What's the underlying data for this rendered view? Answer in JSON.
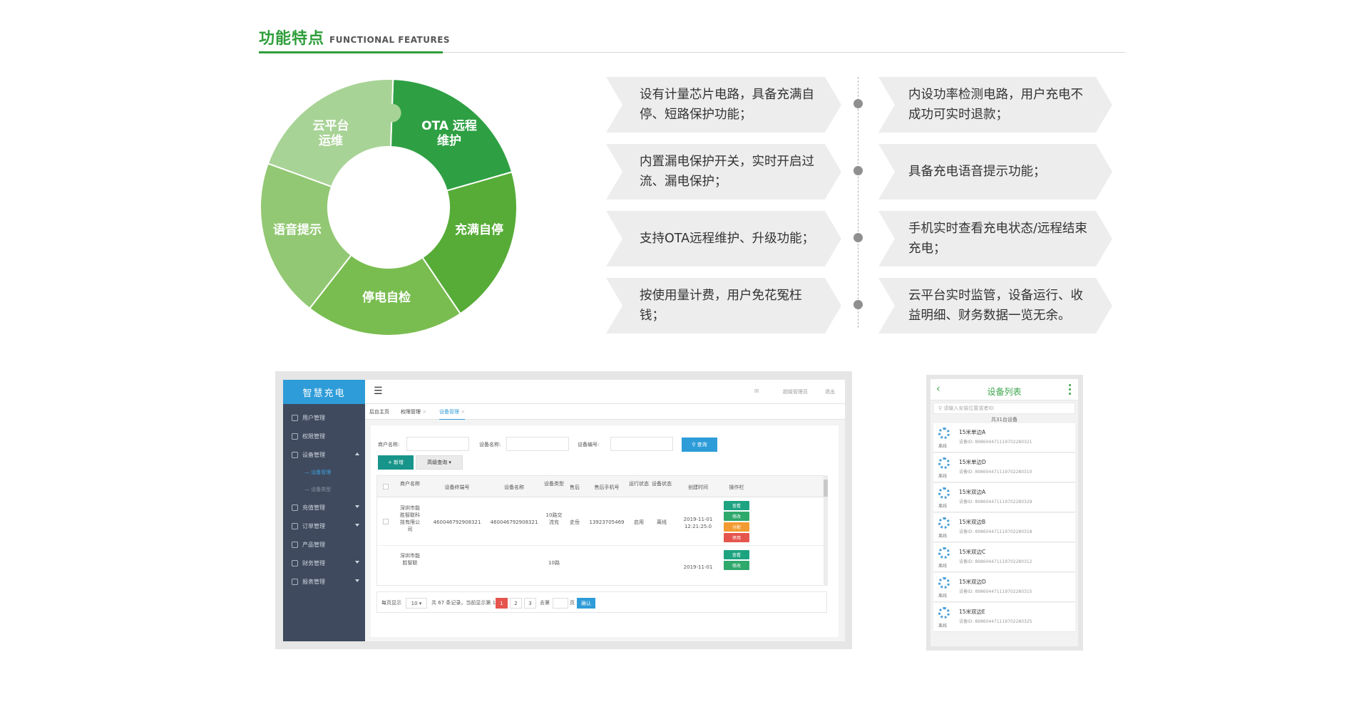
{
  "header": {
    "title_cn": "功能特点",
    "title_en": "FUNCTIONAL FEATURES"
  },
  "wheel": {
    "segments": [
      "OTA 远程维护",
      "充满自停",
      "停电自检",
      "语音提示",
      "云平台运维"
    ],
    "colors": [
      "#2ea043",
      "#57ac38",
      "#79bd50",
      "#92c873",
      "#a8d396"
    ]
  },
  "features": {
    "left": [
      "设有计量芯片电路，具备充满自停、短路保护功能；",
      "内置漏电保护开关，实时开启过流、漏电保护；",
      "支持OTA远程维护、升级功能；",
      "按使用量计费，用户免花冤枉钱；"
    ],
    "right": [
      "内设功率检测电路，用户充电不成功可实时退款；",
      "具备充电语音提示功能；",
      "手机实时查看充电状态/远程结束充电；",
      "云平台实时监管，设备运行、收益明细、财务数据一览无余。"
    ]
  },
  "admin": {
    "logo": "智慧充电",
    "menu_icon": "hamburger-icon",
    "top_right": [
      "☒",
      "超级管理员",
      "退出"
    ],
    "sidebar": [
      {
        "label": "用户管理",
        "icon": "user-icon"
      },
      {
        "label": "权限管理",
        "icon": "key-icon"
      },
      {
        "label": "设备管理",
        "icon": "device-icon"
      },
      {
        "label": "设备管理",
        "icon": "sub-item"
      },
      {
        "label": "设备类型",
        "icon": "sub-item"
      },
      {
        "label": "充值管理",
        "icon": "recharge-icon"
      },
      {
        "label": "订单管理",
        "icon": "order-icon"
      },
      {
        "label": "产品管理",
        "icon": "product-icon"
      },
      {
        "label": "财务管理",
        "icon": "finance-icon"
      },
      {
        "label": "报表管理",
        "icon": "report-icon"
      }
    ],
    "tabs": [
      "后台主页",
      "权限管理",
      "设备管理"
    ],
    "filters": {
      "merchant_label": "商户名称:",
      "device_name_label": "设备名称:",
      "device_no_label": "设备编号:",
      "search_btn": "查询",
      "add_btn": "新增",
      "advanced_btn": "高级查询"
    },
    "table_headers": [
      "商户名称",
      "设备终端号",
      "设备名称",
      "设备类型",
      "售后",
      "售后手机号",
      "运行状态",
      "设备状态",
      "创建时间",
      "操作栏"
    ],
    "rows": [
      {
        "merchant": "深圳市能胜智联科技有限公司",
        "terminal": "460046792908321",
        "name": "460046792908321",
        "type": "10路交流充",
        "after": "史岳",
        "phone": "13923705469",
        "run": "启用",
        "status": "离线",
        "created": "2019-11-01 12:21:25.0"
      },
      {
        "merchant": "深圳市能胜智联",
        "terminal": "",
        "name": "",
        "type": "10路",
        "after": "",
        "phone": "",
        "run": "",
        "status": "",
        "created": "2019-11-01"
      }
    ],
    "ops": [
      "查看",
      "修改",
      "分配",
      "停用"
    ],
    "ops_colors": [
      "#1ea381",
      "#2fa86c",
      "#f29b30",
      "#e5554e"
    ],
    "pager": {
      "per_page_label": "每页显示",
      "per_page": "10",
      "total": "共 67 条记录，当前显示第 1 页",
      "pages": [
        "1",
        "2",
        "3"
      ],
      "jump_label": "去第",
      "page_suffix": "页",
      "confirm": "确认"
    }
  },
  "mobile": {
    "title": "设备列表",
    "search_placeholder": "请输入安装位置或者ID",
    "count": "共31台设备",
    "items": [
      {
        "name": "15米单边A",
        "id": "设备ID: 898604471119702280321",
        "status": "离线"
      },
      {
        "name": "15米单边D",
        "id": "设备ID: 898604471119702280310",
        "status": "离线"
      },
      {
        "name": "15米双边A",
        "id": "设备ID: 898604471119702280329",
        "status": "离线"
      },
      {
        "name": "15米双边B",
        "id": "设备ID: 898604471119702280318",
        "status": "离线"
      },
      {
        "name": "15米双边C",
        "id": "设备ID: 898604471119702280312",
        "status": "离线"
      },
      {
        "name": "15米双边D",
        "id": "设备ID: 898604471119702280315",
        "status": "离线"
      },
      {
        "name": "15米双边E",
        "id": "设备ID: 898604471119702280325",
        "status": "离线"
      }
    ]
  }
}
